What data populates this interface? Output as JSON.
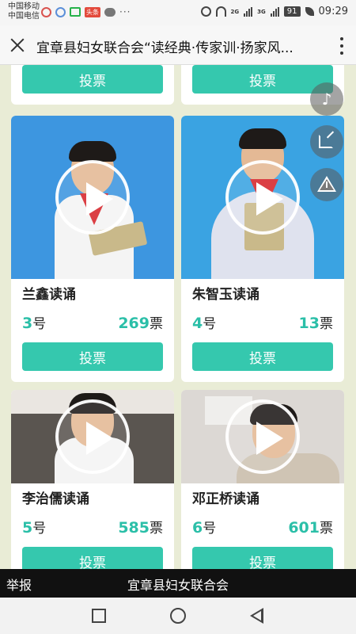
{
  "status_bar": {
    "carrier_1": "中国移动",
    "carrier_2": "中国电信",
    "badge": "头条",
    "more": "···",
    "network_1": "2G",
    "network_2": "3G",
    "battery": "91",
    "time": "09:29"
  },
  "title_bar": {
    "title": "宜章县妇女联合会“读经典·传家训·扬家风..."
  },
  "vote_label": "投票",
  "number_suffix": "号",
  "votes_suffix": "票",
  "cards": [
    {
      "name": "兰鑫读诵",
      "number": "3",
      "votes": "269"
    },
    {
      "name": "朱智玉读诵",
      "number": "4",
      "votes": "13"
    },
    {
      "name": "李治儒读诵",
      "number": "5",
      "votes": "585"
    },
    {
      "name": "邓正桥读诵",
      "number": "6",
      "votes": "601"
    }
  ],
  "side_buttons": [
    "music-icon",
    "share-icon",
    "warning-icon"
  ],
  "bottom_bar": {
    "report": "举报",
    "organization": "宜章县妇女联合会"
  },
  "colors": {
    "accent": "#35c8ae",
    "number_color": "#2bbfa8",
    "page_bg": "#e9ecd6"
  }
}
